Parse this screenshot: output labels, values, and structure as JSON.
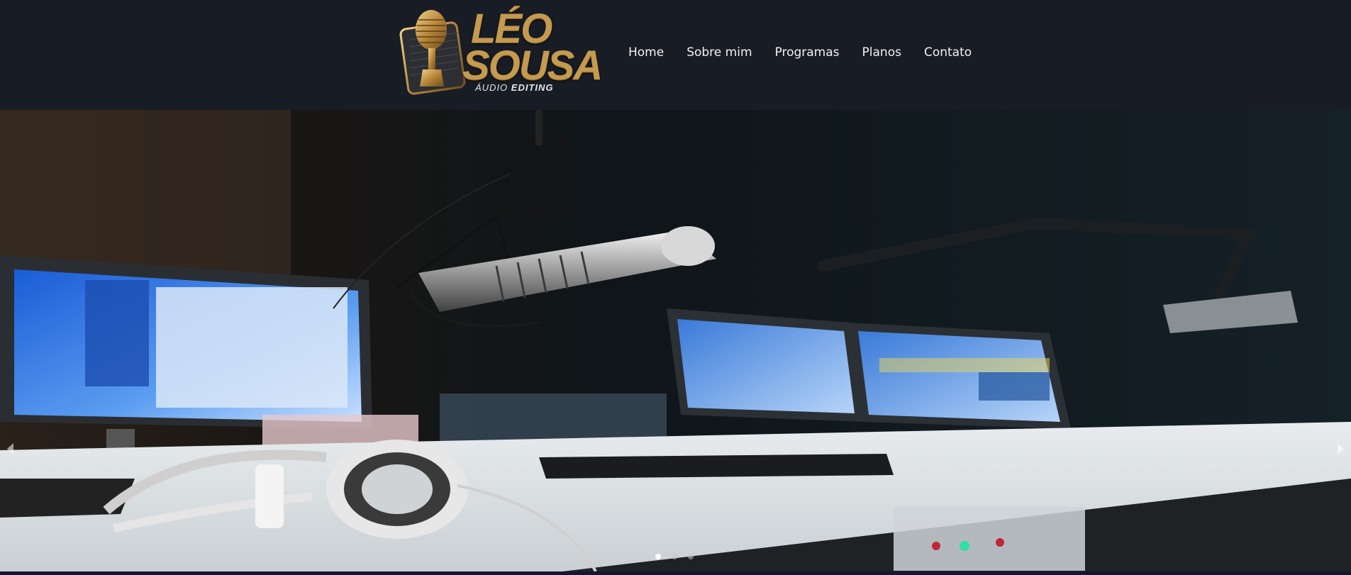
{
  "header": {
    "logo": {
      "line1": "LÉO",
      "line2": "SOUSA",
      "sub_light": "ÁUDIO",
      "sub_bold": "EDITING"
    },
    "nav": [
      "Home",
      "Sobre mim",
      "Programas",
      "Planos",
      "Contato"
    ]
  },
  "carousel": {
    "slide_count": 3,
    "active_index": 0,
    "prev_icon": "caret-left-icon",
    "next_icon": "caret-right-icon"
  },
  "colors": {
    "header_bg": "#181c25",
    "logo_gold": "#c49a4e",
    "nav_text": "#f2f2f2"
  }
}
